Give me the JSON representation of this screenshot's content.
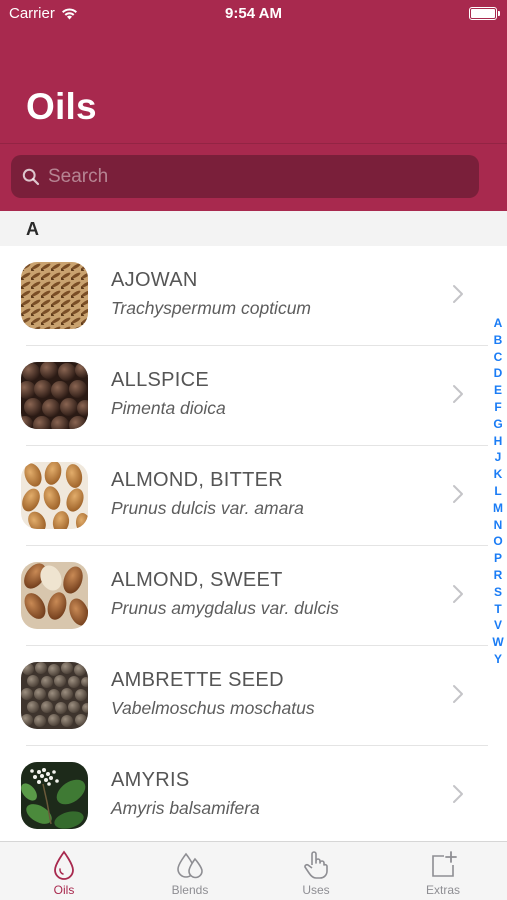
{
  "status_bar": {
    "carrier": "Carrier",
    "time": "9:54 AM"
  },
  "header": {
    "title": "Oils"
  },
  "search": {
    "placeholder": "Search"
  },
  "section": {
    "letter": "A"
  },
  "oils": [
    {
      "name": "AJOWAN",
      "latin": "Trachyspermum copticum",
      "image": "ajowan-seeds"
    },
    {
      "name": "ALLSPICE",
      "latin": "Pimenta dioica",
      "image": "allspice-berries"
    },
    {
      "name": "ALMOND, BITTER",
      "latin": "Prunus dulcis var. amara",
      "image": "bitter-almonds"
    },
    {
      "name": "ALMOND, SWEET",
      "latin": "Prunus amygdalus var. dulcis",
      "image": "sweet-almonds"
    },
    {
      "name": "AMBRETTE SEED",
      "latin": "Vabelmoschus moschatus",
      "image": "ambrette-seeds"
    },
    {
      "name": "AMYRIS",
      "latin": "Amyris balsamifera",
      "image": "amyris-plant"
    }
  ],
  "index_letters": [
    "A",
    "B",
    "C",
    "D",
    "E",
    "F",
    "G",
    "H",
    "J",
    "K",
    "L",
    "M",
    "N",
    "O",
    "P",
    "R",
    "S",
    "T",
    "V",
    "W",
    "Y"
  ],
  "tabs": [
    {
      "label": "Oils",
      "icon": "drop-icon",
      "active": true
    },
    {
      "label": "Blends",
      "icon": "drops-icon",
      "active": false
    },
    {
      "label": "Uses",
      "icon": "hand-pointer-icon",
      "active": false
    },
    {
      "label": "Extras",
      "icon": "add-square-icon",
      "active": false
    }
  ],
  "colors": {
    "brand": "#a8294e",
    "search_bg": "#7a1f3a",
    "index": "#1a7cf5",
    "tab_inactive": "#8e8e93"
  }
}
